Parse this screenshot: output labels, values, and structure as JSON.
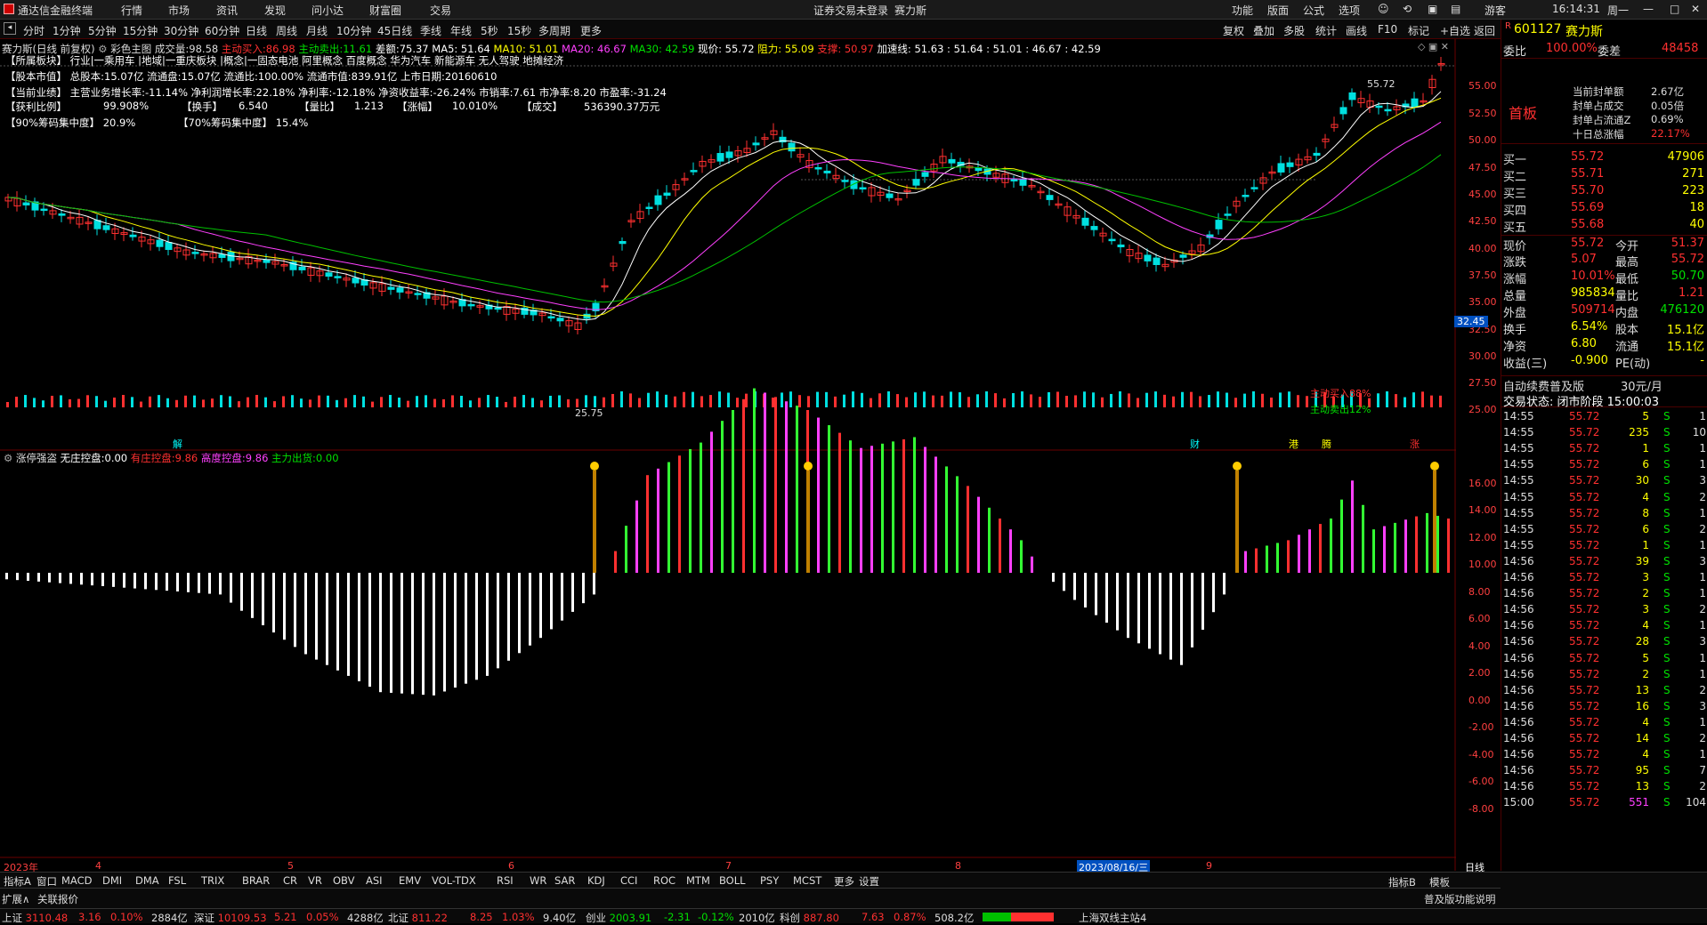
{
  "titlebar": {
    "app_name": "通达信金融终端",
    "menus": [
      "行情",
      "市场",
      "资讯",
      "发现",
      "问小达",
      "财富圈",
      "交易"
    ],
    "notice": "证券交易未登录",
    "stock_short": "赛力斯",
    "right_menus": [
      "功能",
      "版面",
      "公式",
      "选项"
    ],
    "user": "游客",
    "time": "16:14:31",
    "weekday": "周一"
  },
  "periodbar": {
    "items": [
      "分时",
      "1分钟",
      "5分钟",
      "15分钟",
      "30分钟",
      "60分钟",
      "日线",
      "周线",
      "月线",
      "10分钟",
      "45日线",
      "季线",
      "年线",
      "5秒",
      "15秒",
      "多周期",
      "更多"
    ],
    "tools": [
      "复权",
      "叠加",
      "多股",
      "统计",
      "画线",
      "F10",
      "标记",
      "+自选",
      "返回"
    ]
  },
  "main_header": {
    "stock": "赛力斯(日线 前复权)",
    "indicator": "彩色主图",
    "volume_label": "成交量:",
    "volume": "98.58",
    "buy_label": "主动买入:",
    "buy": "86.98",
    "sell_label": "主动卖出:",
    "sell": "11.61",
    "diff_label": "差额:",
    "diff": "75.37",
    "ma5": "MA5: 51.64",
    "ma10": "MA10: 51.01",
    "ma20": "MA20: 46.67",
    "ma30": "MA30: 42.59",
    "price": "现价: 55.72",
    "resist": "阻力: 55.09",
    "support": "支撑: 50.97",
    "accel": "加速线: 51.63 : 51.64 : 51.01 : 46.67 : 42.59"
  },
  "info_lines": {
    "l1": "【所属板块】 行业|一乘用车 |地域|一重庆板块 |概念|一固态电池 阿里概念 百度概念 华为汽车 新能源车 无人驾驶 地摊经济",
    "l2": "【股本市值】 总股本:15.07亿 流通盘:15.07亿 流通比:100.00% 流通市值:839.91亿 上市日期:20160610",
    "l3": "【当前业绩】 主营业务增长率:-11.14% 净利润增长率:22.18% 净利率:-12.18% 净资收益率:-26.24% 市销率:7.61 市净率:8.20 市盈率:-31.24",
    "l4_a": "【获利比例】",
    "l4_b": "99.908%",
    "l4_c": "【换手】",
    "l4_d": "6.540",
    "l4_e": "【量比】",
    "l4_f": "1.213",
    "l4_g": "【涨幅】",
    "l4_h": "10.010%",
    "l4_i": "【成交】",
    "l4_j": "536390.37万元",
    "l5": "【90%筹码集中度】 20.9%",
    "l6": "【70%筹码集中度】 15.4%"
  },
  "price_axis": [
    "55.00",
    "52.50",
    "50.00",
    "47.50",
    "45.00",
    "42.50",
    "40.00",
    "37.50",
    "35.00",
    "32.50",
    "30.00",
    "27.50",
    "25.00"
  ],
  "price_marker": "32.45",
  "max_label": "55.72",
  "min_label": "25.75",
  "buy_pct": "主动买入88%",
  "sell_pct": "主动卖出12%",
  "event_marks": [
    "解",
    "财",
    "港",
    "腾",
    "涨"
  ],
  "sub_header": {
    "name": "涨停强盗",
    "a_label": "无庄控盘:",
    "a": "0.00",
    "b_label": "有庄控盘:",
    "b": "9.86",
    "c_label": "高度控盘:",
    "c": "9.86",
    "d_label": "主力出货:",
    "d": "0.00"
  },
  "sub_axis": [
    "16.00",
    "14.00",
    "12.00",
    "10.00",
    "8.00",
    "6.00",
    "4.00",
    "2.00",
    "0.00",
    "-2.00",
    "-4.00",
    "-6.00",
    "-8.00"
  ],
  "date_axis": {
    "year": "2023年",
    "months": [
      "4",
      "5",
      "6",
      "7",
      "8",
      "9"
    ],
    "cursor": "2023/08/16/三",
    "period": "日线"
  },
  "indicator_tabs": [
    "指标A",
    "窗口",
    "MACD",
    "DMI",
    "DMA",
    "FSL",
    "TRIX",
    "BRAR",
    "CR",
    "VR",
    "OBV",
    "ASI",
    "EMV",
    "VOL-TDX",
    "RSI",
    "WR",
    "SAR",
    "KDJ",
    "CCI",
    "ROC",
    "MTM",
    "BOLL",
    "PSY",
    "MCST",
    "更多",
    "设置"
  ],
  "right_tabs": [
    "指标B",
    "模板"
  ],
  "second_row": [
    "扩展∧",
    "关联报价"
  ],
  "promo": "普及版功能说明",
  "statusbar": {
    "sh_label": "上证",
    "sh": "3110.48",
    "sh_chg": "3.16",
    "sh_pct": "0.10%",
    "sh_amt": "2884亿",
    "sz_label": "深证",
    "sz": "10109.53",
    "sz_chg": "5.21",
    "sz_pct": "0.05%",
    "sz_amt": "4288亿",
    "bz_label": "北证",
    "bz": "811.22",
    "bz_chg": "8.25",
    "bz_pct": "1.03%",
    "bz_amt": "9.40亿",
    "cy_label": "创业",
    "cy": "2003.91",
    "cy_chg": "-2.31",
    "cy_pct": "-0.12%",
    "cy_amt": "2010亿",
    "kc_label": "科创",
    "kc": "887.80",
    "kc_chg": "7.63",
    "kc_pct": "0.87%",
    "kc_amt": "508.2亿",
    "server": "上海双线主站4"
  },
  "quote": {
    "code": "601127",
    "name": "赛力斯",
    "webi_label": "委比",
    "webi": "100.00%",
    "weicha_label": "委差",
    "weicha": "48458",
    "badge": "首板",
    "seal_items": [
      {
        "label": "当前封单额",
        "value": "2.67亿"
      },
      {
        "label": "封单占成交",
        "value": "0.05倍"
      },
      {
        "label": "封单占流通Z",
        "value": "0.69%"
      },
      {
        "label": "十日总涨幅",
        "value": "22.17%"
      }
    ],
    "bids": [
      {
        "label": "买一",
        "price": "55.72",
        "vol": "47906"
      },
      {
        "label": "买二",
        "price": "55.71",
        "vol": "271"
      },
      {
        "label": "买三",
        "price": "55.70",
        "vol": "223"
      },
      {
        "label": "买四",
        "price": "55.69",
        "vol": "18"
      },
      {
        "label": "买五",
        "price": "55.68",
        "vol": "40"
      }
    ],
    "stats": [
      {
        "l1": "现价",
        "v1": "55.72",
        "l2": "今开",
        "v2": "51.37"
      },
      {
        "l1": "涨跌",
        "v1": "5.07",
        "l2": "最高",
        "v2": "55.72"
      },
      {
        "l1": "涨幅",
        "v1": "10.01%",
        "l2": "最低",
        "v2": "50.70"
      },
      {
        "l1": "总量",
        "v1": "985834",
        "l2": "量比",
        "v2": "1.21"
      },
      {
        "l1": "外盘",
        "v1": "509714",
        "l2": "内盘",
        "v2": "476120"
      },
      {
        "l1": "换手",
        "v1": "6.54%",
        "l2": "股本",
        "v2": "15.1亿"
      },
      {
        "l1": "净资",
        "v1": "6.80",
        "l2": "流通",
        "v2": "15.1亿"
      },
      {
        "l1": "收益(三)",
        "v1": "-0.900",
        "l2": "PE(动)",
        "v2": "-"
      }
    ],
    "auto_fee": "自动续费普及版",
    "fee": "30元/月",
    "trade_state": "交易状态: 闭市阶段 15:00:03",
    "ticks": [
      {
        "t": "14:55",
        "p": "55.72",
        "v": "5",
        "s": "S",
        "n": "1"
      },
      {
        "t": "14:55",
        "p": "55.72",
        "v": "235",
        "s": "S",
        "n": "10"
      },
      {
        "t": "14:55",
        "p": "55.72",
        "v": "1",
        "s": "S",
        "n": "1"
      },
      {
        "t": "14:55",
        "p": "55.72",
        "v": "6",
        "s": "S",
        "n": "1"
      },
      {
        "t": "14:55",
        "p": "55.72",
        "v": "30",
        "s": "S",
        "n": "3"
      },
      {
        "t": "14:55",
        "p": "55.72",
        "v": "4",
        "s": "S",
        "n": "2"
      },
      {
        "t": "14:55",
        "p": "55.72",
        "v": "8",
        "s": "S",
        "n": "1"
      },
      {
        "t": "14:55",
        "p": "55.72",
        "v": "6",
        "s": "S",
        "n": "2"
      },
      {
        "t": "14:55",
        "p": "55.72",
        "v": "1",
        "s": "S",
        "n": "1"
      },
      {
        "t": "14:56",
        "p": "55.72",
        "v": "39",
        "s": "S",
        "n": "3"
      },
      {
        "t": "14:56",
        "p": "55.72",
        "v": "3",
        "s": "S",
        "n": "1"
      },
      {
        "t": "14:56",
        "p": "55.72",
        "v": "2",
        "s": "S",
        "n": "1"
      },
      {
        "t": "14:56",
        "p": "55.72",
        "v": "3",
        "s": "S",
        "n": "2"
      },
      {
        "t": "14:56",
        "p": "55.72",
        "v": "4",
        "s": "S",
        "n": "1"
      },
      {
        "t": "14:56",
        "p": "55.72",
        "v": "28",
        "s": "S",
        "n": "3"
      },
      {
        "t": "14:56",
        "p": "55.72",
        "v": "5",
        "s": "S",
        "n": "1"
      },
      {
        "t": "14:56",
        "p": "55.72",
        "v": "2",
        "s": "S",
        "n": "1"
      },
      {
        "t": "14:56",
        "p": "55.72",
        "v": "13",
        "s": "S",
        "n": "2"
      },
      {
        "t": "14:56",
        "p": "55.72",
        "v": "16",
        "s": "S",
        "n": "3"
      },
      {
        "t": "14:56",
        "p": "55.72",
        "v": "4",
        "s": "S",
        "n": "1"
      },
      {
        "t": "14:56",
        "p": "55.72",
        "v": "14",
        "s": "S",
        "n": "2"
      },
      {
        "t": "14:56",
        "p": "55.72",
        "v": "4",
        "s": "S",
        "n": "1"
      },
      {
        "t": "14:56",
        "p": "55.72",
        "v": "95",
        "s": "S",
        "n": "7"
      },
      {
        "t": "14:56",
        "p": "55.72",
        "v": "13",
        "s": "S",
        "n": "2"
      },
      {
        "t": "15:00",
        "p": "55.72",
        "v": "551",
        "s": "S",
        "n": "104"
      }
    ]
  },
  "colors": {
    "up": "#ff3030",
    "down": "#00e0e0",
    "ma5": "#ffffff",
    "ma10": "#ffff00",
    "ma20": "#ff40ff",
    "ma30": "#00c000"
  }
}
